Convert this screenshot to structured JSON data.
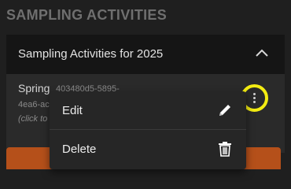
{
  "section": {
    "title": "SAMPLING ACTIVITIES"
  },
  "accordion": {
    "title": "Sampling Activities for 2025",
    "toggle_icon": "chevron-up-icon"
  },
  "item": {
    "name": "Spring",
    "id_part1": "403480d5-5895-",
    "id_part2": "4ea6-ac",
    "hint": "(click to"
  },
  "kebab": {
    "icon": "more-vertical-icon",
    "highlight_color": "#f3ec12"
  },
  "menu": {
    "items": [
      {
        "label": "Edit",
        "icon": "pencil-icon"
      },
      {
        "label": "Delete",
        "icon": "trash-icon"
      }
    ]
  },
  "colors": {
    "background": "#1f1f1f",
    "header_bg": "#151515",
    "accent_orange": "#b5501a"
  }
}
